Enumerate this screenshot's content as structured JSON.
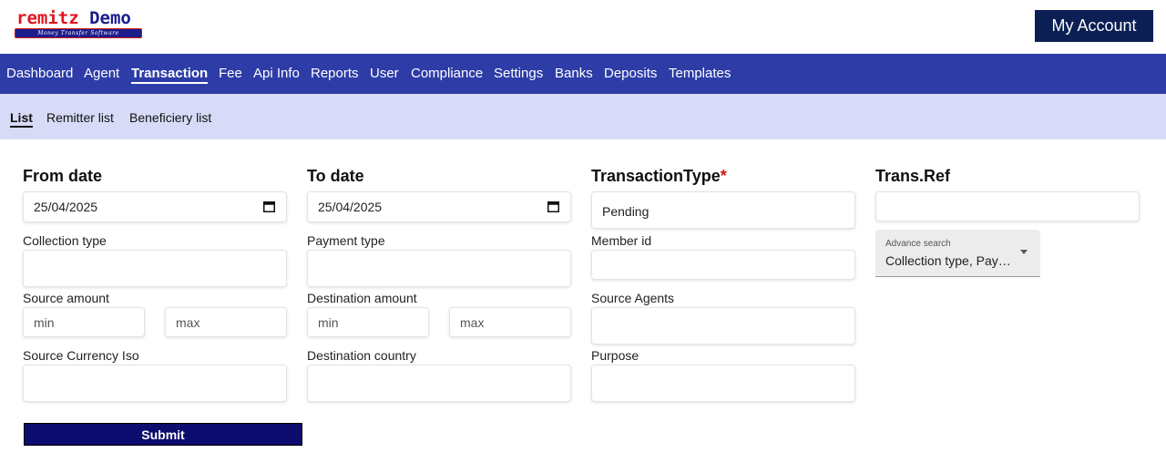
{
  "brand": {
    "name_part1": "remitz",
    "name_part2": "Demo",
    "tagline": "Money Transfer Software"
  },
  "header": {
    "account_label": "My Account"
  },
  "main_nav": {
    "items": [
      "Dashboard",
      "Agent",
      "Transaction",
      "Fee",
      "Api Info",
      "Reports",
      "User",
      "Compliance",
      "Settings",
      "Banks",
      "Deposits",
      "Templates"
    ],
    "active": "Transaction"
  },
  "sub_nav": {
    "items": [
      "List",
      "Remitter list",
      "Beneficiery list"
    ],
    "active": "List"
  },
  "form": {
    "from_date": {
      "label": "From date",
      "value": "25/04/2025"
    },
    "to_date": {
      "label": "To date",
      "value": "25/04/2025"
    },
    "transaction_type": {
      "label": "TransactionType",
      "required_mark": "*",
      "value": "Pending"
    },
    "trans_ref": {
      "label": "Trans.Ref",
      "value": ""
    },
    "advance_search": {
      "label": "Advance search",
      "value": "Collection type, Payment type"
    },
    "collection_type": {
      "label": "Collection type",
      "value": ""
    },
    "payment_type": {
      "label": "Payment type",
      "value": ""
    },
    "member_id": {
      "label": "Member id",
      "value": ""
    },
    "source_amount": {
      "label": "Source amount",
      "min_placeholder": "min",
      "max_placeholder": "max"
    },
    "destination_amount": {
      "label": "Destination amount",
      "min_placeholder": "min",
      "max_placeholder": "max"
    },
    "source_agents": {
      "label": "Source Agents",
      "value": ""
    },
    "source_currency_iso": {
      "label": "Source Currency Iso",
      "value": ""
    },
    "destination_country": {
      "label": "Destination country",
      "value": ""
    },
    "purpose": {
      "label": "Purpose",
      "value": ""
    },
    "submit_label": "Submit"
  },
  "colors": {
    "nav_bg": "#2d3ca6",
    "subnav_bg": "#d7dbf7",
    "account_btn": "#0b1f55",
    "submit_btn": "#0c0c6e",
    "required": "#d21818"
  }
}
